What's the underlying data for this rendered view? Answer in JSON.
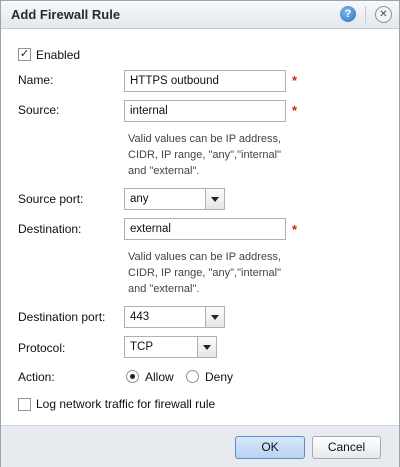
{
  "dialog": {
    "title": "Add Firewall Rule",
    "help_glyph": "?",
    "close_glyph": "✕"
  },
  "enabled": {
    "label": "Enabled",
    "checked": true,
    "glyph": "✓"
  },
  "name": {
    "label": "Name:",
    "value": "HTTPS outbound",
    "required_mark": "*"
  },
  "source": {
    "label": "Source:",
    "value": "internal",
    "required_mark": "*",
    "hint_lines": [
      "Valid values can be IP address,",
      "CIDR, IP range, \"any\",\"internal\"",
      "and \"external\"."
    ]
  },
  "source_port": {
    "label": "Source port:",
    "value": "any"
  },
  "destination": {
    "label": "Destination:",
    "value": "external",
    "required_mark": "*",
    "hint_lines": [
      "Valid values can be IP address,",
      "CIDR, IP range, \"any\",\"internal\"",
      "and \"external\"."
    ]
  },
  "destination_port": {
    "label": "Destination port:",
    "value": "443"
  },
  "protocol": {
    "label": "Protocol:",
    "value": "TCP"
  },
  "action": {
    "label": "Action:",
    "options": [
      "Allow",
      "Deny"
    ],
    "selected": "Allow"
  },
  "log": {
    "label": "Log network traffic for firewall rule",
    "checked": false
  },
  "buttons": {
    "ok": "OK",
    "cancel": "Cancel"
  },
  "colors": {
    "required": "#d0201c",
    "primary_button": "#b8d3f2",
    "help_icon": "#2a73c4"
  },
  "icons": [
    "help-icon",
    "close-icon",
    "checkbox",
    "chevron-down-icon",
    "radio"
  ]
}
